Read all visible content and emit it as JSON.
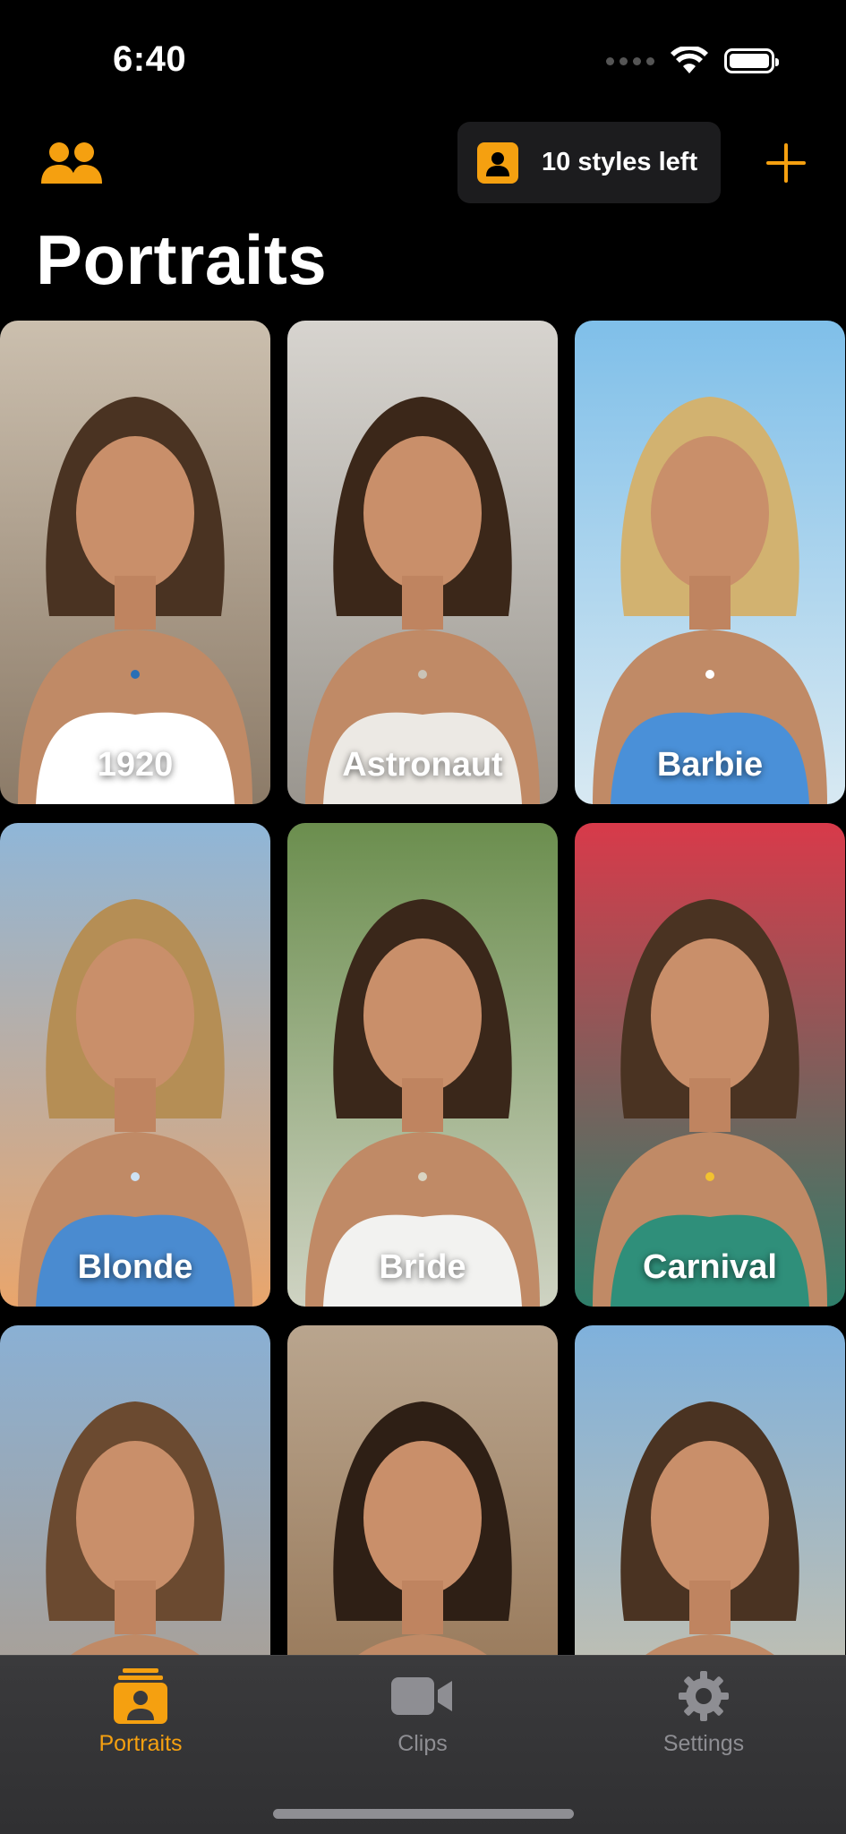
{
  "status_bar": {
    "time": "6:40"
  },
  "header": {
    "styles_left": "10 styles left",
    "title": "Portraits"
  },
  "portraits": [
    {
      "label": "1920",
      "bg": [
        "#cbbfae",
        "#8c7b68"
      ],
      "hair": "#4a3322",
      "top": "#ffffff",
      "accent": "#2a6fb5"
    },
    {
      "label": "Astronaut",
      "bg": [
        "#d7d4cf",
        "#9a968f"
      ],
      "hair": "#3b2719",
      "top": "#ece9e4",
      "accent": "#c9c3b6"
    },
    {
      "label": "Barbie",
      "bg": [
        "#7fbfe9",
        "#d8e9f2"
      ],
      "hair": "#d2b270",
      "top": "#4a90d8",
      "accent": "#ffffff"
    },
    {
      "label": "Blonde",
      "bg": [
        "#8fb6d8",
        "#e9a56c"
      ],
      "hair": "#b58e55",
      "top": "#4a8bd0",
      "accent": "#cde2f5"
    },
    {
      "label": "Bride",
      "bg": [
        "#6b8e4e",
        "#cfd3c3"
      ],
      "hair": "#3a271a",
      "top": "#f2f2f0",
      "accent": "#d9d4c2"
    },
    {
      "label": "Carnival",
      "bg": [
        "#d83a4a",
        "#2f7f6a"
      ],
      "hair": "#4a3322",
      "top": "#2f8f7a",
      "accent": "#f2c230"
    },
    {
      "label": "",
      "bg": [
        "#8ab0d4",
        "#b59a80"
      ],
      "hair": "#6b4a30",
      "top": "#dfe8f2",
      "accent": "#ffffff"
    },
    {
      "label": "",
      "bg": [
        "#b9a58e",
        "#8d6a48"
      ],
      "hair": "#2e1f15",
      "top": "#c9a060",
      "accent": "#e2c26a"
    },
    {
      "label": "",
      "bg": [
        "#7fb1dc",
        "#d8c4a2"
      ],
      "hair": "#4a3322",
      "top": "#9ab6d8",
      "accent": "#e8d7b5"
    }
  ],
  "tabs": [
    {
      "label": "Portraits",
      "icon": "portrait-icon",
      "active": true
    },
    {
      "label": "Clips",
      "icon": "video-camera-icon",
      "active": false
    },
    {
      "label": "Settings",
      "icon": "gear-icon",
      "active": false
    }
  ],
  "colors": {
    "accent": "#f5a010",
    "background": "#000000",
    "tabbar": "#363638"
  }
}
